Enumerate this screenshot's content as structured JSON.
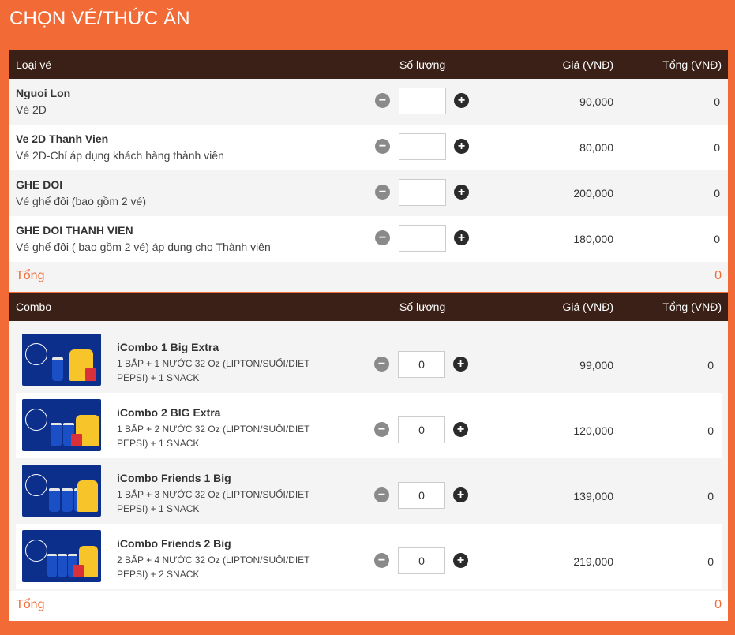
{
  "page": {
    "title": "CHỌN VÉ/THỨC ĂN"
  },
  "tickets": {
    "headers": {
      "name": "Loại vé",
      "quantity": "Số lượng",
      "price": "Giá (VNĐ)",
      "total": "Tổng (VNĐ)"
    },
    "rows": [
      {
        "name": "Nguoi Lon",
        "desc": "Vé 2D",
        "quantity": "",
        "price": "90,000",
        "total": "0"
      },
      {
        "name": "Ve 2D Thanh Vien",
        "desc": "Vé 2D-Chỉ áp dụng khách hàng thành viên",
        "quantity": "",
        "price": "80,000",
        "total": "0"
      },
      {
        "name": "GHE DOI",
        "desc": "Vé ghế đôi (bao gồm 2 vé)",
        "quantity": "",
        "price": "200,000",
        "total": "0"
      },
      {
        "name": "GHE DOI THANH VIEN",
        "desc": "Vé ghế đôi ( bao gồm 2 vé) áp dụng cho Thành viên",
        "quantity": "",
        "price": "180,000",
        "total": "0"
      }
    ],
    "summary": {
      "label": "Tổng",
      "value": "0"
    }
  },
  "combos": {
    "headers": {
      "name": "Combo",
      "quantity": "Số lượng",
      "price": "Giá (VNĐ)",
      "total": "Tổng (VNĐ)"
    },
    "rows": [
      {
        "name": "iCombo 1 Big Extra",
        "desc_line1": "1 BẮP + 1 NƯỚC 32 Oz (LIPTON/SUỐI/DIET",
        "desc_line2": "PEPSI) + 1 SNACK",
        "quantity": "0",
        "price": "99,000",
        "total": "0"
      },
      {
        "name": "iCombo 2 BIG Extra",
        "desc_line1": "1 BẮP + 2 NƯỚC 32 Oz (LIPTON/SUỐI/DIET",
        "desc_line2": "PEPSI) + 1 SNACK",
        "quantity": "0",
        "price": "120,000",
        "total": "0"
      },
      {
        "name": "iCombo Friends 1 Big",
        "desc_line1": "1 BẮP + 3 NƯỚC 32 Oz (LIPTON/SUỐI/DIET",
        "desc_line2": "PEPSI) + 1 SNACK",
        "quantity": "0",
        "price": "139,000",
        "total": "0"
      },
      {
        "name": "iCombo Friends 2 Big",
        "desc_line1": "2 BẮP + 4 NƯỚC 32 Oz (LIPTON/SUỐI/DIET",
        "desc_line2": "PEPSI) + 2 SNACK",
        "quantity": "0",
        "price": "219,000",
        "total": "0"
      }
    ],
    "summary": {
      "label": "Tổng",
      "value": "0"
    }
  },
  "controls": {
    "minus": "−",
    "plus": "+"
  },
  "colors": {
    "accent": "#f26b37",
    "header_bg": "#3a2016",
    "row_alt": "#f4f4f4"
  }
}
